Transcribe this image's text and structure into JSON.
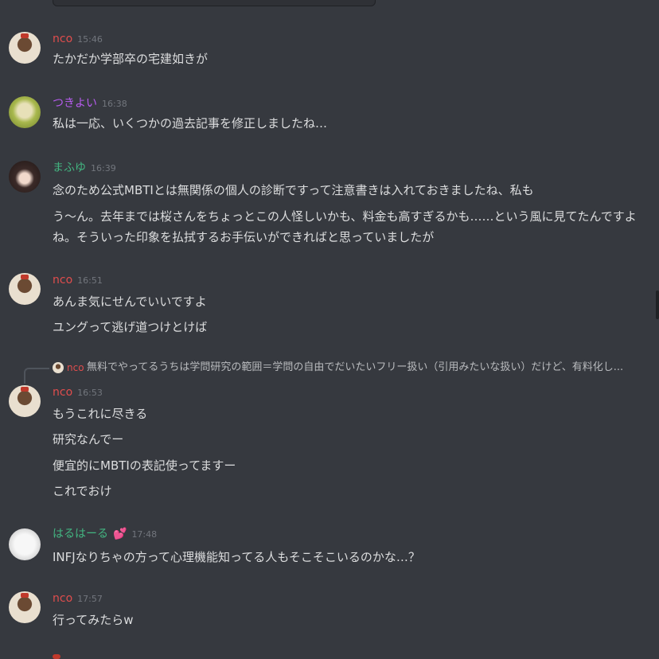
{
  "colors": {
    "background": "#36393f",
    "nco": "#e04d4d",
    "tsukiyoi": "#b85cf0",
    "mafuyu": "#43b581",
    "harukaaru": "#43b581",
    "timestamp": "#72767d",
    "text": "#dcddde"
  },
  "messages": [
    {
      "author": "nco",
      "time": "15:46",
      "lines": [
        "たかだか学部卒の宅建如きが"
      ]
    },
    {
      "author": "つきよい",
      "time": "16:38",
      "lines": [
        "私は一応、いくつかの過去記事を修正しましたね…"
      ]
    },
    {
      "author": "まふゆ",
      "time": "16:39",
      "lines": [
        "念のため公式MBTIとは無関係の個人の診断ですって注意書きは入れておきましたね、私も",
        "う～ん。去年までは桜さんをちょっとこの人怪しいかも、料金も高すぎるかも……という風に見てたんですよ",
        "ね。そういった印象を払拭するお手伝いができればと思っていましたが"
      ]
    },
    {
      "author": "nco",
      "time": "16:51",
      "lines": [
        "あんま気にせんでいいですよ",
        "ユングって逃げ道つけとけば"
      ]
    },
    {
      "reply": {
        "author": "nco",
        "text": "無料でやってるうちは学問研究の範囲＝学問の自由でだいたいフリー扱い（引用みたいな扱い）だけど、有料化し..."
      },
      "author": "nco",
      "time": "16:53",
      "lines": [
        "もうこれに尽きる",
        "研究なんでー",
        "便宜的にMBTIの表記使ってますー",
        "これでおけ"
      ]
    },
    {
      "author": "はるはーる",
      "time": "17:48",
      "heart": "💕",
      "lines": [
        "INFJなりちゃの方って心理機能知ってる人もそこそこいるのかな…？"
      ]
    },
    {
      "author": "nco",
      "time": "17:57",
      "lines": [
        "行ってみたらw"
      ]
    }
  ]
}
